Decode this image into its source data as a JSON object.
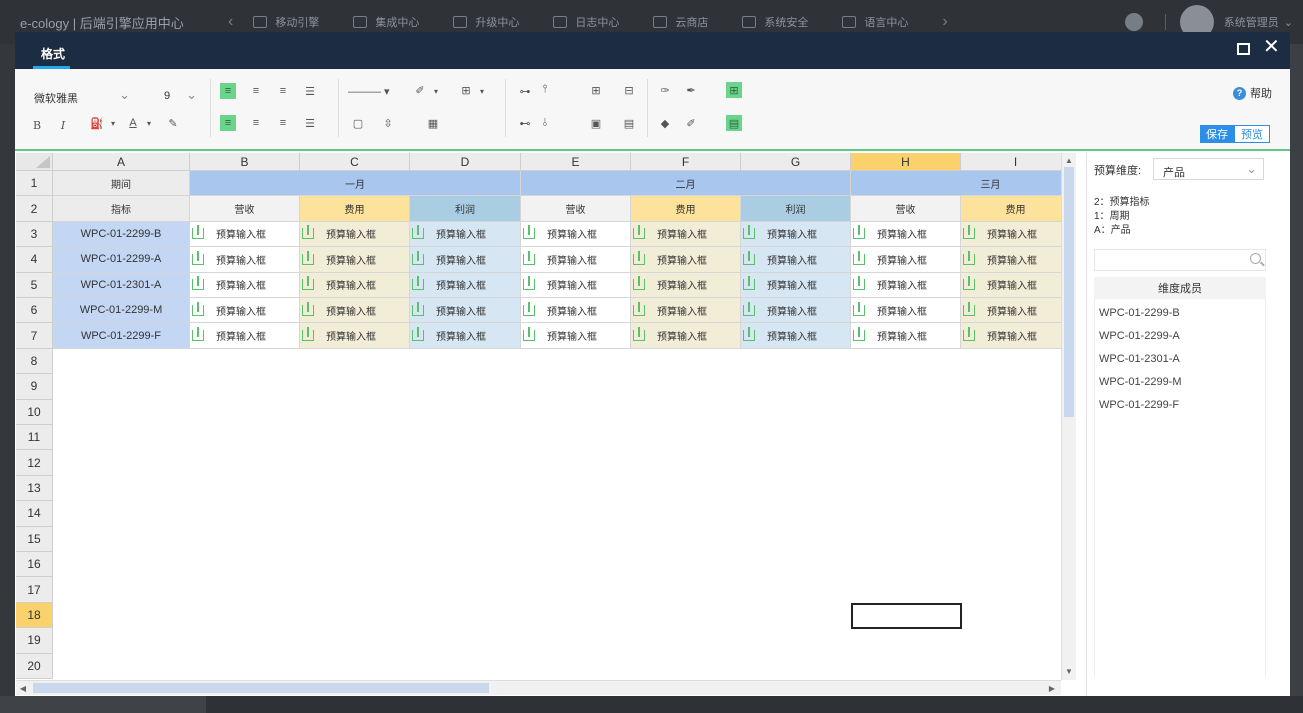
{
  "topbar": {
    "brand": "e-cology | 后端引擎应用中心",
    "nav": [
      "移动引擎",
      "集成中心",
      "升级中心",
      "日志中心",
      "云商店",
      "系统安全",
      "语言中心"
    ],
    "user": "系统管理员"
  },
  "dialog": {
    "tab": "格式",
    "maximize_icon": "maximize-icon",
    "close_icon": "close-icon"
  },
  "ribbon": {
    "font": "微软雅黑",
    "size": "9",
    "bold": "B",
    "italic": "I",
    "help": "帮助",
    "save": "保存",
    "preview": "预览"
  },
  "grid": {
    "columns": [
      "A",
      "B",
      "C",
      "D",
      "E",
      "F",
      "G",
      "H",
      "I"
    ],
    "selected_column": "H",
    "rows": [
      "1",
      "2",
      "3",
      "4",
      "5",
      "6",
      "7",
      "8",
      "9",
      "10",
      "11",
      "12",
      "13",
      "14",
      "15",
      "16",
      "17",
      "18",
      "19",
      "20"
    ],
    "selected_row": "18",
    "row1": {
      "a": "期间",
      "groups": [
        "一月",
        "二月",
        "三月"
      ]
    },
    "row2": [
      "指标",
      "营收",
      "费用",
      "利润",
      "营收",
      "费用",
      "利润",
      "营收",
      "费用"
    ],
    "products": [
      "WPC-01-2299-B",
      "WPC-01-2299-A",
      "WPC-01-2301-A",
      "WPC-01-2299-M",
      "WPC-01-2299-F"
    ],
    "input_label": "预算输入框"
  },
  "panel": {
    "label": "预算维度:",
    "dimension": "产品",
    "lines": [
      "2：预算指标",
      "1：周期",
      "A：产品"
    ],
    "search_placeholder": "",
    "list_header": "维度成员",
    "members": [
      "WPC-01-2299-B",
      "WPC-01-2299-A",
      "WPC-01-2301-A",
      "WPC-01-2299-M",
      "WPC-01-2299-F"
    ]
  },
  "colors": {
    "header_bg": "#1c2d43",
    "accent_blue": "#2c8ee6",
    "accent_green": "#6bd48c",
    "period_blue": "#a9c6ef",
    "product_blue": "#c3d7f4",
    "cost_yellow": "#fde29b",
    "cost_cell": "#f2edd7",
    "profit_cell": "#d6e6f3",
    "profit_head": "#a9cde3",
    "selected_yellow": "#fad16a"
  }
}
